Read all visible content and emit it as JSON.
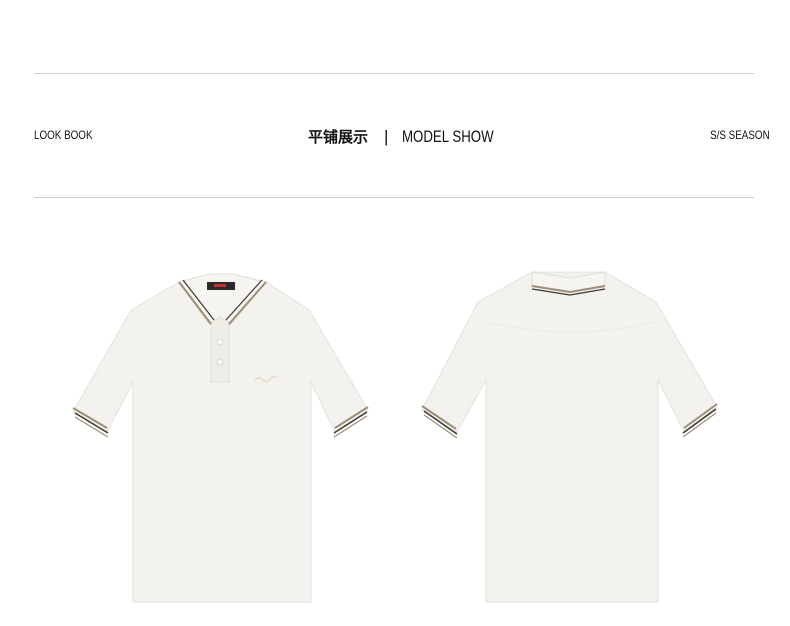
{
  "header": {
    "left_label": "LOOK BOOK",
    "center_cn": "平铺展示",
    "separator": "|",
    "center_en": "MODEL SHOW",
    "right_label": "S/S SEASON"
  },
  "products": [
    {
      "view": "front",
      "type": "polo shirt",
      "color": "#f3f2ee"
    },
    {
      "view": "back",
      "type": "polo shirt",
      "color": "#f3f2ee"
    }
  ],
  "colors": {
    "shirt": "#f3f2ee",
    "stripe_tan": "#9d8f76",
    "stripe_dark": "#3a3834",
    "rule": "#cfcfcf"
  }
}
